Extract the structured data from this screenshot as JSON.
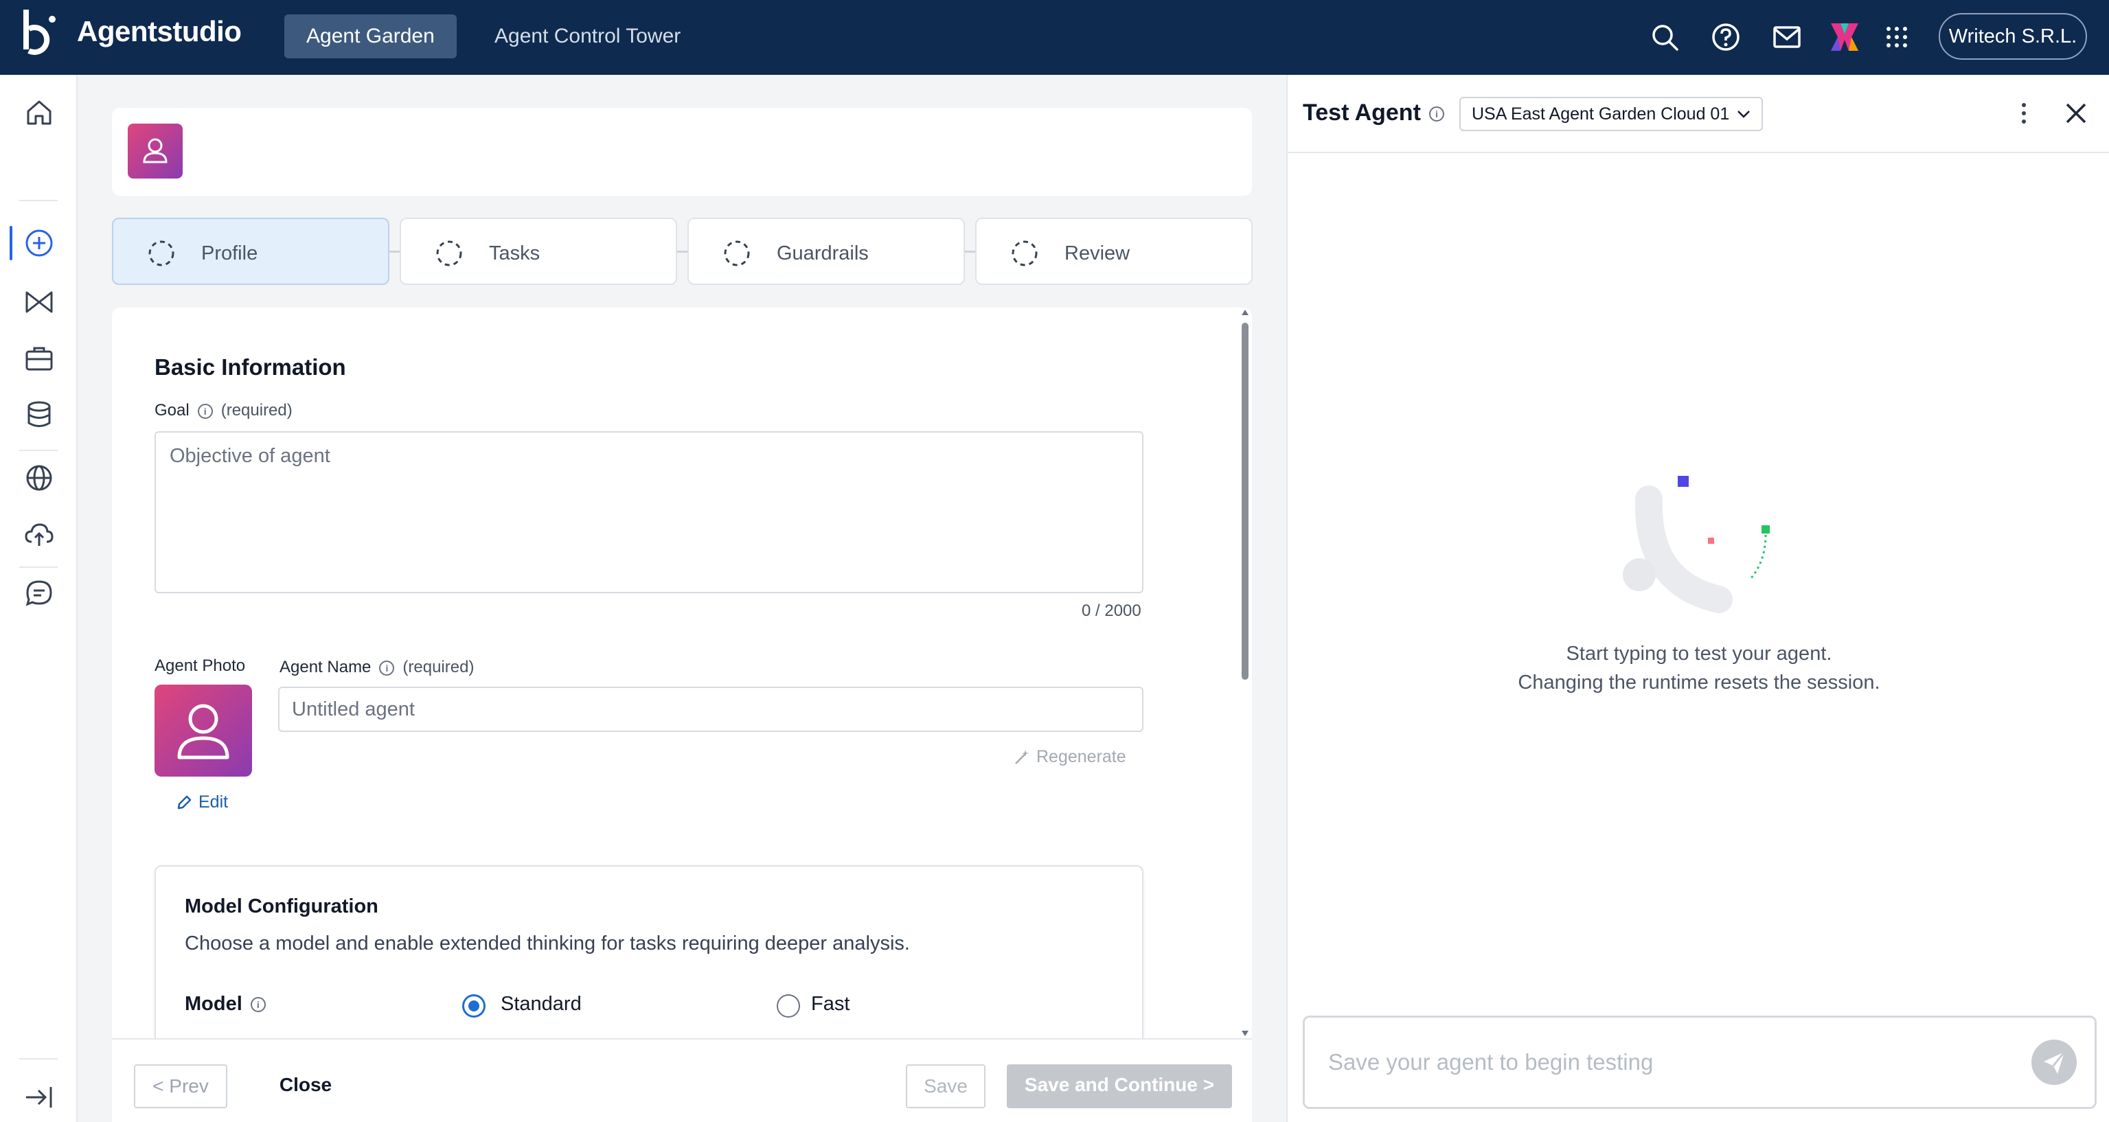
{
  "topbar": {
    "app_name": "Agentstudio",
    "tabs": [
      {
        "label": "Agent Garden",
        "active": true
      },
      {
        "label": "Agent Control Tower",
        "active": false
      }
    ],
    "icons": [
      "search-icon",
      "help-icon",
      "mail-icon",
      "apps-logo-icon",
      "grid-icon"
    ],
    "org_name": "Writech S.R.L.",
    "bg_color": "#0f2a4f"
  },
  "sidebar": {
    "items": [
      "home-icon",
      "create-icon",
      "bowtie-icon",
      "briefcase-icon",
      "database-icon",
      "globe-icon",
      "cloud-upload-icon",
      "chat-icon"
    ],
    "active_item": "create-icon",
    "bottom": "expand-icon"
  },
  "steps": [
    {
      "label": "Profile",
      "active": true
    },
    {
      "label": "Tasks",
      "active": false
    },
    {
      "label": "Guardrails",
      "active": false
    },
    {
      "label": "Review",
      "active": false
    }
  ],
  "form": {
    "section_title": "Basic Information",
    "goal": {
      "label": "Goal",
      "required": "(required)",
      "placeholder": "Objective of agent",
      "counter": "0 / 2000"
    },
    "photo": {
      "label": "Agent Photo",
      "edit_label": "Edit"
    },
    "agent_name": {
      "label": "Agent Name",
      "required": "(required)",
      "placeholder": "Untitled agent",
      "regenerate_label": "Regenerate"
    },
    "model_config": {
      "title": "Model Configuration",
      "description": "Choose a model and enable extended thinking for tasks requiring deeper analysis.",
      "model_label": "Model",
      "options": [
        {
          "label": "Standard",
          "selected": true
        },
        {
          "label": "Fast",
          "selected": false
        }
      ]
    }
  },
  "footer": {
    "prev_label": "< Prev",
    "close_label": "Close",
    "save_label": "Save",
    "save_continue_label": "Save and Continue >"
  },
  "test_panel": {
    "title": "Test Agent",
    "runtime": "USA East Agent Garden Cloud 01",
    "message_line1": "Start typing to test your agent.",
    "message_line2": "Changing the runtime resets the session.",
    "input_placeholder": "Save your agent to begin testing"
  }
}
